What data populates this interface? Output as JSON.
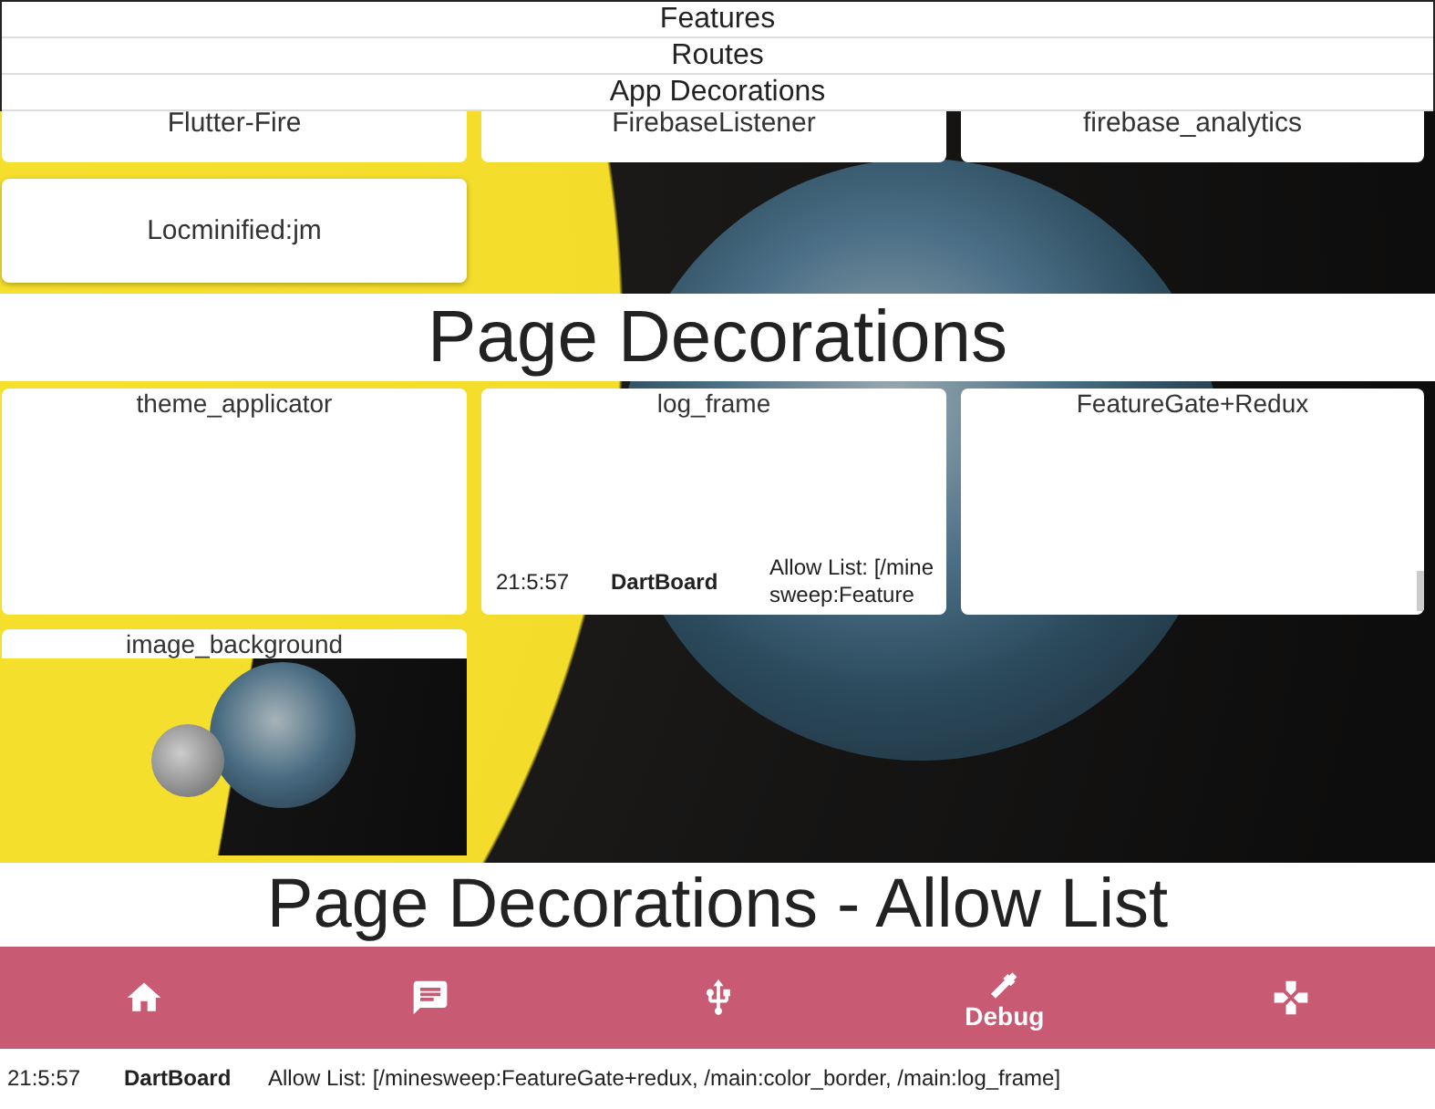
{
  "header_sections": [
    {
      "title": "Features"
    },
    {
      "title": "Routes"
    },
    {
      "title": "App Decorations"
    }
  ],
  "app_decoration_cards": [
    {
      "title": "Flutter-Fire"
    },
    {
      "title": "FirebaseListener"
    },
    {
      "title": "firebase_analytics"
    },
    {
      "title": "Locminified:jm"
    }
  ],
  "page_decorations": {
    "title": "Page Decorations",
    "cards": [
      {
        "title": "theme_applicator",
        "kind": "blank"
      },
      {
        "title": "log_frame",
        "kind": "log",
        "log": {
          "time": "21:5:57",
          "source": "DartBoard",
          "message": "Allow List: [/minesweep:Feature"
        }
      },
      {
        "title": "FeatureGate+Redux",
        "kind": "scroll"
      },
      {
        "title": "image_background",
        "kind": "image"
      }
    ]
  },
  "allow_list": {
    "title": "Page Decorations - Allow List"
  },
  "bottom_nav": [
    {
      "kind": "home",
      "selected": false
    },
    {
      "kind": "chat",
      "selected": false
    },
    {
      "kind": "usb",
      "selected": false
    },
    {
      "kind": "wrench",
      "label": "Debug",
      "selected": true
    },
    {
      "kind": "gamepad",
      "selected": false
    }
  ],
  "log_line": {
    "time": "21:5:57",
    "source": "DartBoard",
    "message": "Allow List: [/minesweep:FeatureGate+redux, /main:color_border, /main:log_frame]"
  }
}
